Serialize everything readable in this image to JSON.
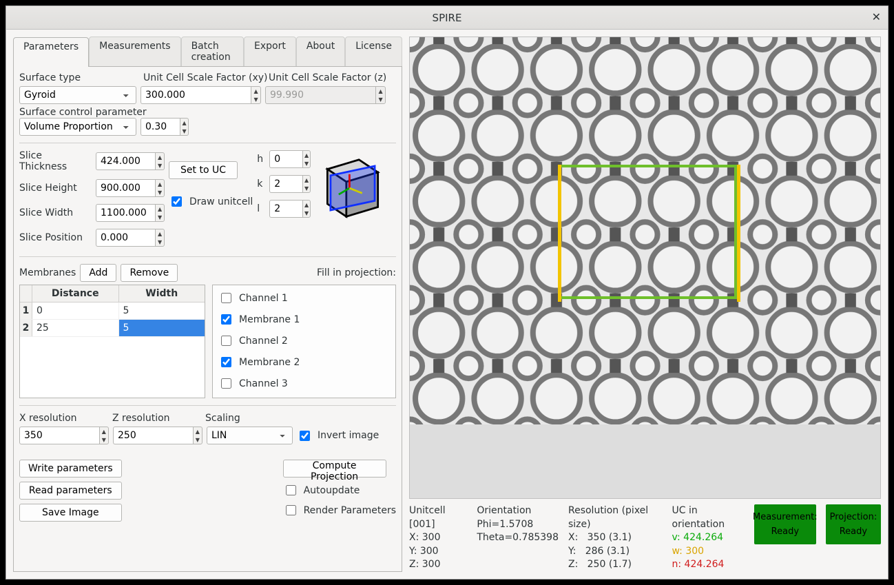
{
  "window": {
    "title": "SPIRE"
  },
  "tabs": [
    "Parameters",
    "Measurements",
    "Batch creation",
    "Export",
    "About",
    "License"
  ],
  "surface": {
    "type_label": "Surface type",
    "type_value": "Gyroid",
    "xy_label": "Unit Cell Scale Factor (xy)",
    "xy_value": "300.000",
    "z_label": "Unit Cell Scale Factor  (z)",
    "z_value": "99.990",
    "ctrl_label": "Surface control parameter",
    "ctrl_value": "Volume Proportion",
    "ctrl_num": "0.30"
  },
  "slice": {
    "thickness_label": "Slice Thickness",
    "thickness": "424.000",
    "height_label": "Slice Height",
    "height": "900.000",
    "width_label": "Slice Width",
    "width": "1100.000",
    "position_label": "Slice Position",
    "position": "0.000",
    "set_to_uc": "Set to UC",
    "draw_uc": "Draw unitcell",
    "h_label": "h",
    "h": "0",
    "k_label": "k",
    "k": "2",
    "l_label": "l",
    "l": "2"
  },
  "membranes": {
    "label": "Membranes",
    "add": "Add",
    "remove": "Remove",
    "fill_label": "Fill in projection:",
    "headers": {
      "dist": "Distance",
      "width": "Width"
    },
    "rows": [
      {
        "idx": "1",
        "dist": "0",
        "width": "5",
        "sel": false
      },
      {
        "idx": "2",
        "dist": "25",
        "width": "5",
        "sel": true
      }
    ],
    "channels": [
      {
        "label": "Channel 1",
        "checked": false
      },
      {
        "label": "Membrane 1",
        "checked": true
      },
      {
        "label": "Channel 2",
        "checked": false
      },
      {
        "label": "Membrane 2",
        "checked": true
      },
      {
        "label": "Channel 3",
        "checked": false
      }
    ]
  },
  "res": {
    "x_label": "X resolution",
    "x": "350",
    "z_label": "Z resolution",
    "z": "250",
    "scaling_label": "Scaling",
    "scaling": "LIN",
    "invert": "Invert image"
  },
  "actions": {
    "write": "Write parameters",
    "read": "Read parameters",
    "save": "Save Image",
    "compute": "Compute Projection",
    "auto": "Autoupdate",
    "render": "Render Parameters"
  },
  "status": {
    "uc_title": "Unitcell [001]",
    "uc_x": "X: 300",
    "uc_y": "Y: 300",
    "uc_z": "Z: 300",
    "orient_title": "Orientation",
    "phi": "Phi=1.5708",
    "theta": "Theta=0.785398",
    "res_title": "Resolution (pixel size)",
    "rx": "X:   350 (3.1)",
    "ry": "Y:   286 (3.1)",
    "rz": "Z:   250 (1.7)",
    "uco_title": "UC in orientation",
    "uco_v": "v: 424.264",
    "uco_w": "w: 300",
    "uco_n": "n: 424.264",
    "badge1a": "Measurement:",
    "badge1b": "Ready",
    "badge2a": "Projection:",
    "badge2b": "Ready"
  }
}
